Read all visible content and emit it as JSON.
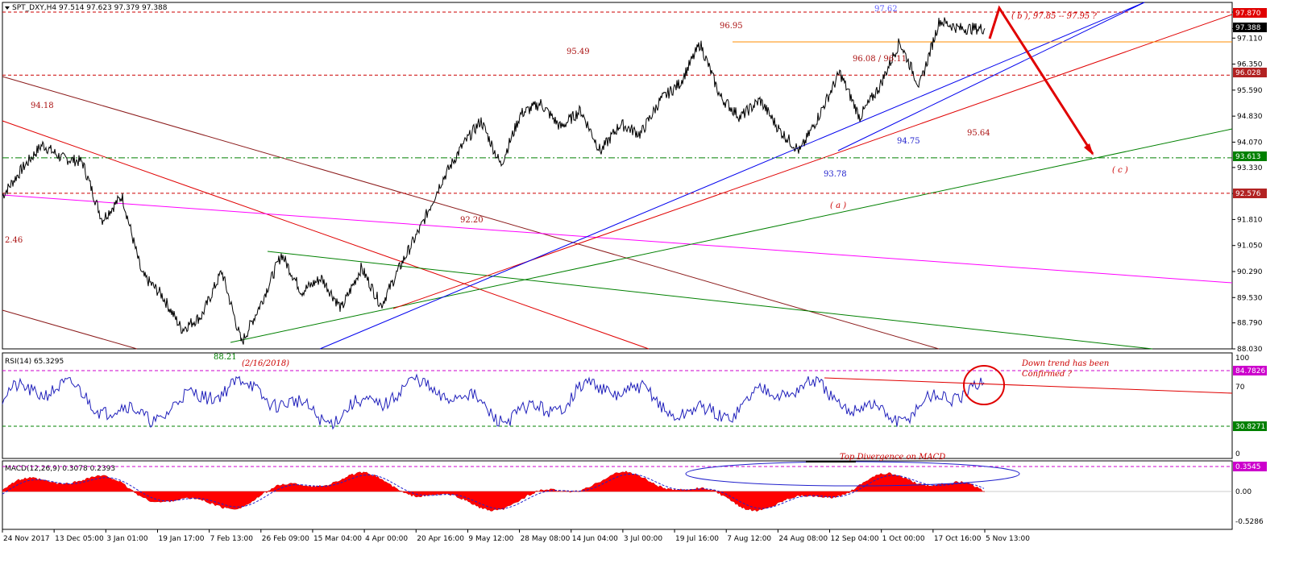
{
  "main_panel": {
    "header": "SPT_DXY,H4  97.514 97.623 97.379 97.388",
    "price_levels": [
      {
        "label": "97.870",
        "value": 97.87,
        "color": "#cc0000",
        "style": "dash"
      },
      {
        "label": "96.028",
        "value": 96.028,
        "color": "#cc0000",
        "style": "dash"
      },
      {
        "label": "93.613",
        "value": 93.613,
        "color": "#008000",
        "style": "dashdot"
      },
      {
        "label": "92.576",
        "value": 92.576,
        "color": "#cc0000",
        "style": "dash"
      }
    ],
    "current_price": "97.388",
    "annotations": [
      {
        "text": "97.62",
        "color": "#6060ff"
      },
      {
        "text": "96.95",
        "color": "#aa1111"
      },
      {
        "text": "95.49",
        "color": "#aa1111"
      },
      {
        "text": "96.08 / 96.11",
        "color": "#aa1111"
      },
      {
        "text": "94.75",
        "color": "#2020cc"
      },
      {
        "text": "95.64",
        "color": "#aa1111"
      },
      {
        "text": "93.78",
        "color": "#2020cc"
      },
      {
        "text": "94.18",
        "color": "#aa1111"
      },
      {
        "text": "92.20",
        "color": "#aa1111"
      },
      {
        "text": "2.46",
        "color": "#aa1111"
      },
      {
        "text": "88.21",
        "color": "#008000"
      },
      {
        "text": "(2/16/2018)",
        "color": "#cc0000"
      },
      {
        "text": "( b ),  97.85 -- 97.95  ?",
        "color": "#cc0000"
      },
      {
        "text": "( a )",
        "color": "#cc0000"
      },
      {
        "text": "( c )",
        "color": "#cc0000"
      }
    ]
  },
  "rsi_panel": {
    "header": "RSI(14) 65.3295",
    "levels": [
      {
        "label": "84.7826",
        "color": "#cc00cc"
      },
      {
        "label": "30.8271",
        "color": "#008000"
      }
    ],
    "annotation": "Down trend has been Confirmed ?"
  },
  "macd_panel": {
    "header": "MACD(12,26,9) 0.3078 0.2393",
    "level_label": "0.3545",
    "annotation": "Top Divergence on MACD"
  },
  "chart_data": {
    "type": "line",
    "title": "SPT_DXY,H4",
    "x_ticks": [
      "24 Nov 2017",
      "13 Dec 05:00",
      "3 Jan 01:00",
      "19 Jan 17:00",
      "7 Feb 13:00",
      "26 Feb 09:00",
      "15 Mar 04:00",
      "4 Apr 00:00",
      "20 Apr 16:00",
      "9 May 12:00",
      "28 May 08:00",
      "14 Jun 04:00",
      "3 Jul 00:00",
      "19 Jul 16:00",
      "7 Aug 12:00",
      "24 Aug 08:00",
      "12 Sep 04:00",
      "1 Oct 00:00",
      "17 Oct 16:00",
      "5 Nov 13:00"
    ],
    "y_ticks": [
      "97.870",
      "97.388",
      "97.110",
      "96.350",
      "95.590",
      "94.830",
      "94.070",
      "93.330",
      "92.570",
      "91.810",
      "91.050",
      "90.290",
      "89.530",
      "88.790",
      "88.030"
    ],
    "ylim": [
      88.03,
      97.87
    ],
    "series": [
      {
        "name": "SPT_DXY",
        "x": [
          0,
          2,
          4,
          6,
          8,
          10,
          12,
          14,
          16,
          18,
          20,
          22,
          24,
          26,
          28,
          30,
          32,
          34,
          36,
          38,
          40,
          42,
          44,
          46,
          48,
          50,
          52,
          54,
          56,
          58,
          60,
          62,
          64,
          66,
          68,
          70,
          72,
          74,
          76,
          78,
          80,
          82,
          84,
          86,
          88,
          90,
          92,
          94,
          96,
          98,
          100
        ],
        "values": [
          92.5,
          93.3,
          94.0,
          93.6,
          93.5,
          91.8,
          92.5,
          90.2,
          89.6,
          88.6,
          89.0,
          90.3,
          88.2,
          89.4,
          90.8,
          89.7,
          90.1,
          89.2,
          90.4,
          89.3,
          90.5,
          91.6,
          92.9,
          93.9,
          94.7,
          93.4,
          94.9,
          95.2,
          94.5,
          95.0,
          93.8,
          94.6,
          94.3,
          95.3,
          95.8,
          96.95,
          95.4,
          94.8,
          95.3,
          94.4,
          93.8,
          94.9,
          96.1,
          94.8,
          95.7,
          97.0,
          95.7,
          97.62,
          97.39,
          97.39,
          97.39
        ]
      }
    ],
    "rsi": {
      "name": "RSI(14)",
      "last": 65.3295,
      "levels": [
        84.7826,
        30.8271
      ],
      "ylim": [
        0,
        100
      ],
      "y_ticks": [
        "100",
        "70",
        "0"
      ]
    },
    "macd": {
      "name": "MACD(12,26,9)",
      "main": 0.3078,
      "signal": 0.2393,
      "level": 0.3545,
      "y_ticks": [
        "0.00",
        "-0.5286"
      ]
    },
    "grid": false
  }
}
